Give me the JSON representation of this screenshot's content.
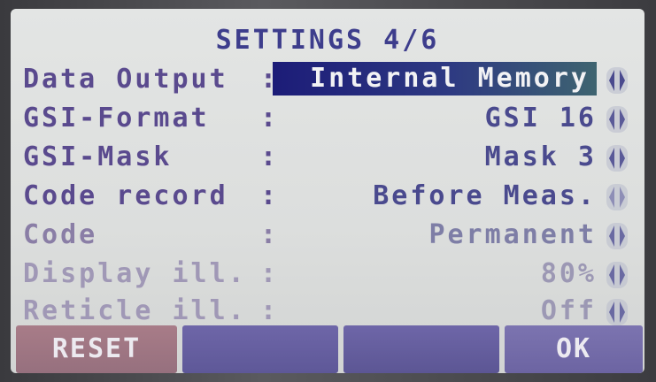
{
  "screen": {
    "title": "SETTINGS 4/6"
  },
  "settings": [
    {
      "label": "Data Output",
      "colon": ":",
      "value": "Internal Memory"
    },
    {
      "label": "GSI-Format",
      "colon": ":",
      "value": "GSI 16"
    },
    {
      "label": "GSI-Mask",
      "colon": ":",
      "value": "Mask 3"
    },
    {
      "label": "Code record",
      "colon": ":",
      "value": "Before Meas."
    },
    {
      "label": "Code",
      "colon": ":",
      "value": "Permanent"
    },
    {
      "label": "Display ill.",
      "colon": ":",
      "value": "80%"
    },
    {
      "label": "Reticle ill.",
      "colon": ":",
      "value": "Off"
    }
  ],
  "softkeys": {
    "f1": "RESET",
    "f2": "",
    "f3": "",
    "f4": "OK"
  },
  "colors": {
    "title": "#3d3d8c",
    "label": "#5a4a8e",
    "selected_bg": "#1c1c78",
    "reset_key": "#a87c88",
    "key": "#6e66a8"
  },
  "icons": {
    "selector_arrows": "left-right-arrows-icon"
  }
}
